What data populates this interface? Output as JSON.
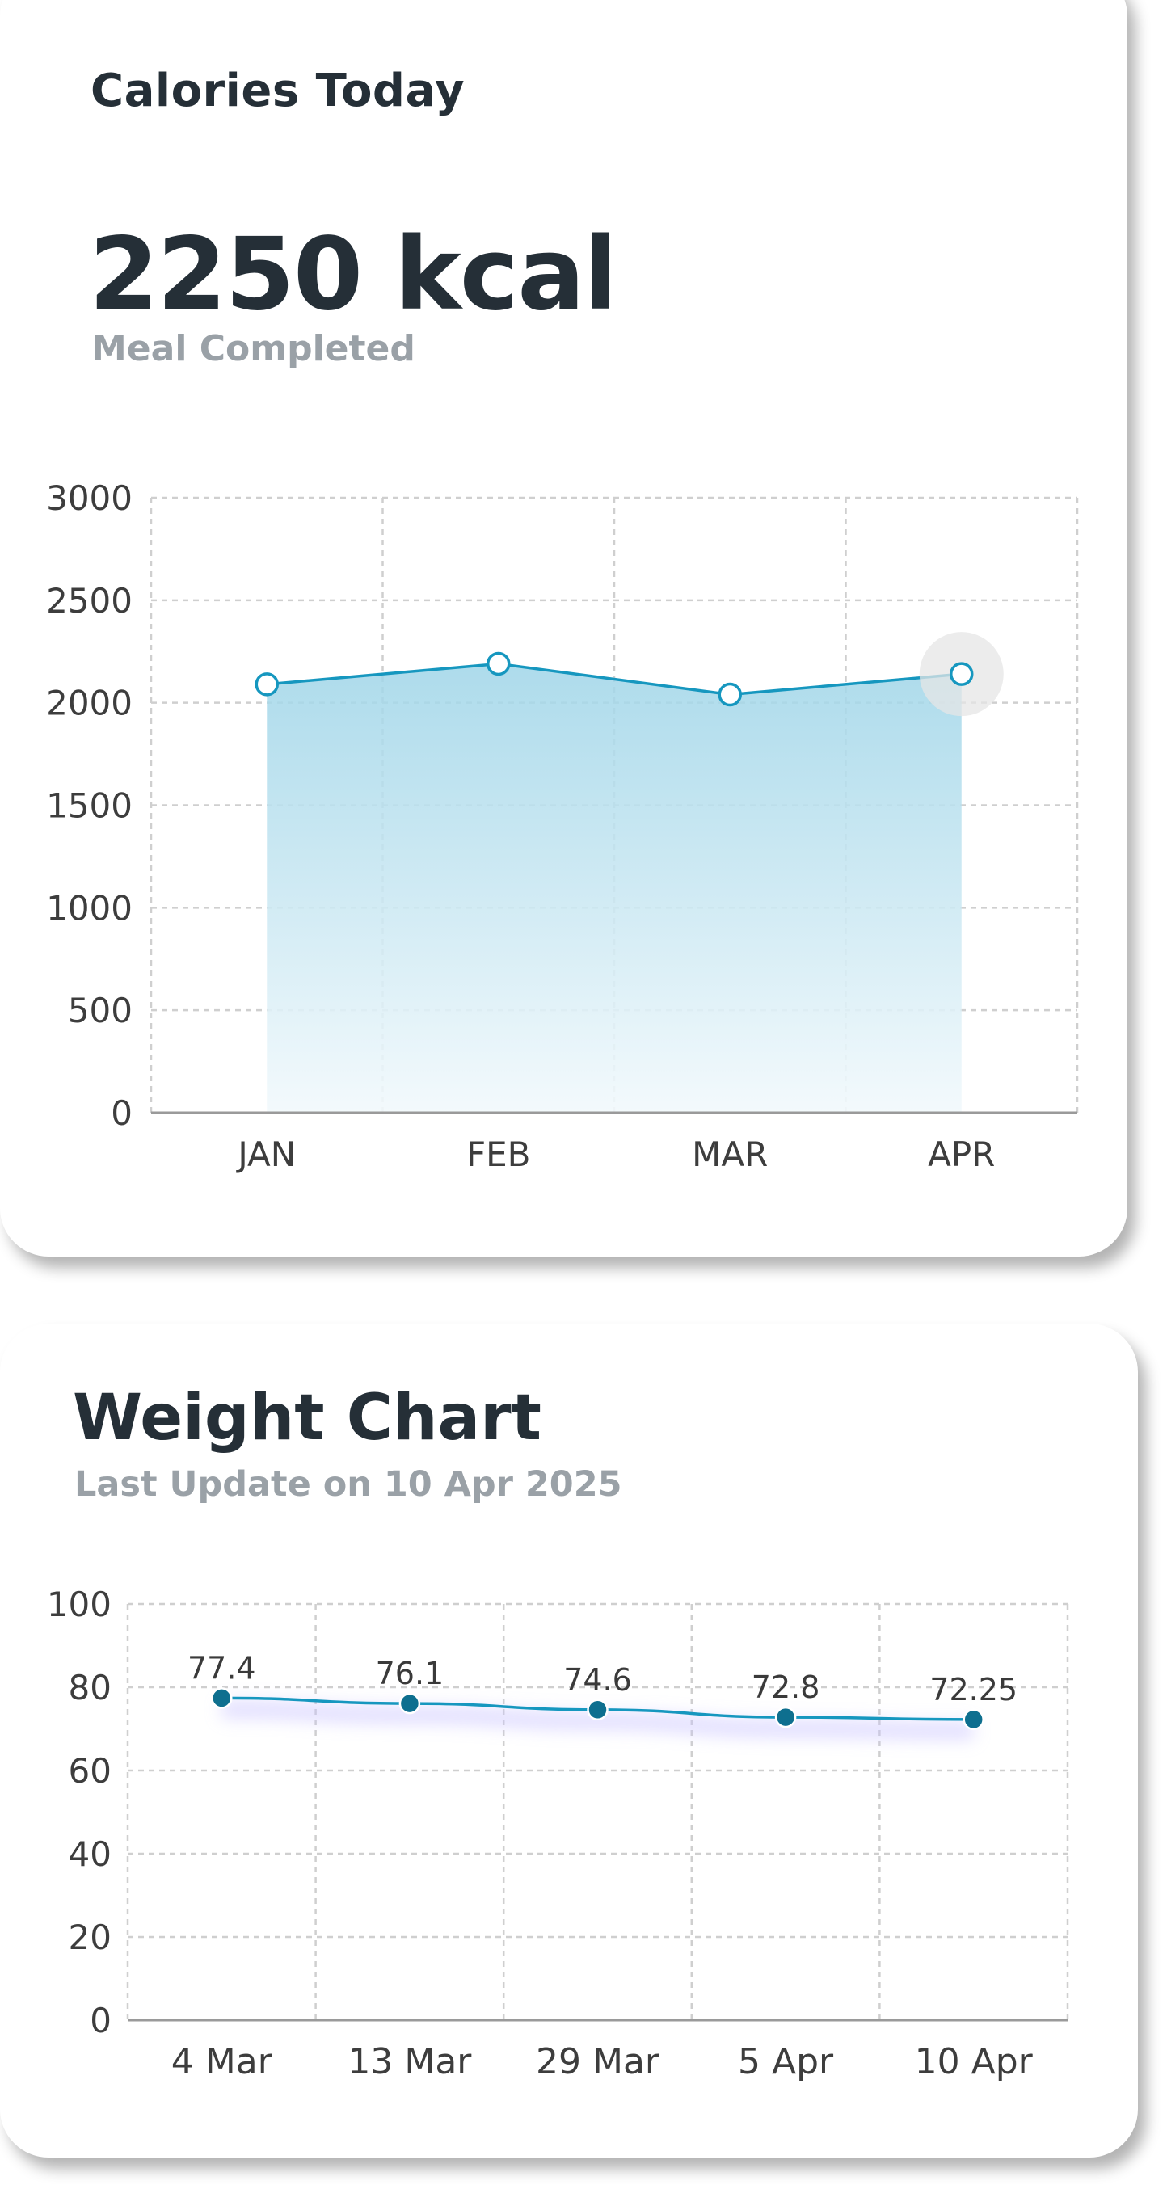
{
  "calories_card": {
    "title": "Calories Today",
    "value": "2250 kcal",
    "subtitle": "Meal Completed"
  },
  "weight_card": {
    "title": "Weight Chart",
    "subtitle": "Last Update on 10 Apr 2025"
  },
  "colors": {
    "line": "#1697bf",
    "marker_dark": "#0e6f8f",
    "area_top": "#9fd5e8",
    "area_bottom": "#f2f9fc",
    "grid": "#cfcfcf",
    "axis": "#9a9a9a",
    "title": "#252f37",
    "subtitle": "#9aa1a7"
  },
  "chart_data": [
    {
      "type": "area",
      "categories": [
        "JAN",
        "FEB",
        "MAR",
        "APR"
      ],
      "series": [
        {
          "values": [
            2090,
            2190,
            2040,
            2140
          ]
        }
      ],
      "ylim": [
        0,
        3000
      ],
      "yticks": [
        0,
        500,
        1000,
        1500,
        2000,
        2500,
        3000
      ],
      "grid": true,
      "highlighted_point": "APR"
    },
    {
      "type": "line",
      "categories": [
        "4 Mar",
        "13 Mar",
        "29 Mar",
        "5 Apr",
        "10 Apr"
      ],
      "series": [
        {
          "values": [
            77.4,
            76.1,
            74.6,
            72.8,
            72.25
          ]
        }
      ],
      "data_labels": [
        "77.4",
        "76.1",
        "74.6",
        "72.8",
        "72.25"
      ],
      "ylim": [
        0,
        100
      ],
      "yticks": [
        0,
        20,
        40,
        60,
        80,
        100
      ],
      "grid": true
    }
  ]
}
